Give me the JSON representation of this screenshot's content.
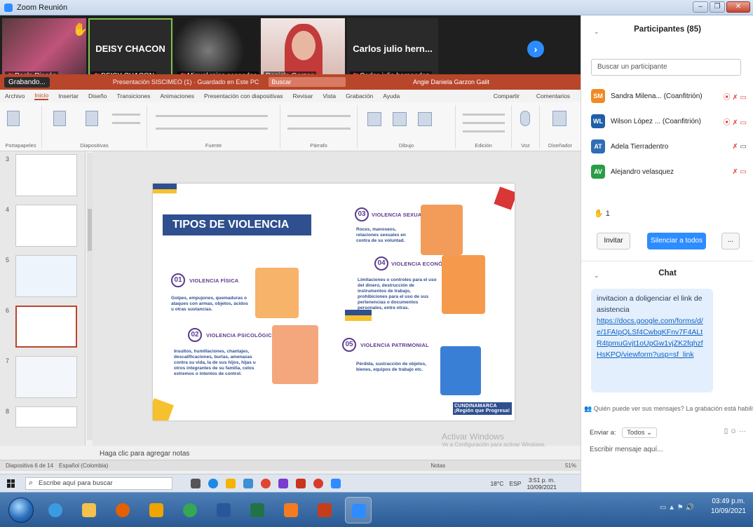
{
  "window": {
    "title": "Zoom Reunión",
    "controls": [
      "–",
      "❐",
      "✕"
    ]
  },
  "gallery": {
    "tiles": [
      {
        "name": "Paola Rincón",
        "big_name": "",
        "raised_hand": true
      },
      {
        "name": "DEISY CHACON",
        "big_name": "DEISY CHACON",
        "raised_hand": false
      },
      {
        "name": "Miguel rojas cespedes",
        "big_name": "",
        "raised_hand": false
      },
      {
        "name": "Daniela Garzon",
        "big_name": "",
        "raised_hand": false
      },
      {
        "name": "Carlos julio hernandez",
        "big_name": "Carlos julio hern...",
        "raised_hand": false
      }
    ],
    "next_label": "›"
  },
  "ppt": {
    "recording_label": "Grabando...",
    "file_name": "Presentación SISCIMEO (1) · Guardado en Este PC",
    "search": "Buscar",
    "user": "Angie Daniela Garzon Galit",
    "menu": [
      "Archivo",
      "Inicio",
      "Insertar",
      "Diseño",
      "Transiciones",
      "Animaciones",
      "Presentación con diapositivas",
      "Revisar",
      "Vista",
      "Grabación",
      "Ayuda"
    ],
    "share": "Compartir",
    "comments": "Comentarios",
    "ribbon_groups": [
      "Portapapeles",
      "Diapositivas",
      "Fuente",
      "Párrafo",
      "Dibujo",
      "Edición",
      "Voz",
      "Diseñador"
    ],
    "thumb_numbers": [
      "3",
      "4",
      "5",
      "6",
      "7",
      "8"
    ],
    "slide": {
      "title": "TIPOS DE VIOLENCIA",
      "items": [
        {
          "num": "01",
          "label": "VIOLENCIA FÍSICA",
          "desc": "Golpes, empujones, quemaduras o ataques con armas, objetos, ácidos u otras sustancias."
        },
        {
          "num": "02",
          "label": "VIOLENCIA PSICOLÓGICA",
          "desc": "Insultos, humillaciones, chantajes, descalificaciones, burlas, amenazas contra su vida, la de sus hijos, hijas u otros integrantes de su familia, celos extremos o intentos de control."
        },
        {
          "num": "03",
          "label": "VIOLENCIA SEXUAL",
          "desc": "Roces, manoseos, relaciones sexuales en contra de su voluntad."
        },
        {
          "num": "04",
          "label": "VIOLENCIA ECONÓMICA",
          "desc": "Limitaciones o controles para el uso del dinero, destrucción de instrumentos de trabajo, prohibiciones para el uso de sus pertenencias o documentos personales, entre otras."
        },
        {
          "num": "05",
          "label": "VIOLENCIA PATRIMONIAL",
          "desc": "Pérdida, sustracción de objetos, bienes, equipos de trabajo etc."
        }
      ],
      "logo": "CUNDINAMARCA ¡Región que Progresa!"
    },
    "notes_hint": "Haga clic para agregar notas",
    "activate_windows": "Activar Windows",
    "activate_sub": "Ve a Configuración para activar Windows.",
    "status_slide": "Diapositiva 6 de 14",
    "status_lang": "Español (Colombia)",
    "status_notes": "Notas",
    "status_zoom": "51%"
  },
  "inner_taskbar": {
    "search_placeholder": "Escribe aquí para buscar",
    "weather": "18°C",
    "lang": "ESP",
    "time": "3:51 p. m.",
    "date": "10/09/2021"
  },
  "participants": {
    "header": "Participantes (85)",
    "search_placeholder": "Buscar un participante",
    "people": [
      {
        "initials": "SM",
        "name": "Sandra Milena... (Coanfitrión)",
        "color": "#f08a24"
      },
      {
        "initials": "WL",
        "name": "Wilson López ... (Coanfitrión)",
        "color": "#1f5fa8"
      },
      {
        "initials": "AT",
        "name": "Adela Tierradentro",
        "color": "#2f6db5"
      },
      {
        "initials": "AV",
        "name": "Alejandro velasquez",
        "color": "#2a9d46"
      }
    ],
    "raised_count": "1",
    "invite": "Invitar",
    "mute_all": "Silenciar a todos",
    "more": "..."
  },
  "chat": {
    "header": "Chat",
    "message": "invitacion a doligenciar el link de asistencia",
    "link": "https://docs.google.com/forms/d/e/1FAIpQLSf4CwbqKFnv7F4ALtR4tpmuGvjt1oUpGw1vjZK2fqhzfHsKPQ/viewform?usp=sf_link",
    "warning": "Quién puede ver sus mensajes? La grabación está habilitada",
    "send_to_label": "Enviar a:",
    "send_to_value": "Todos",
    "input_placeholder": "Escribir mensaje aquí..."
  },
  "taskbar": {
    "time": "03:49 p.m.",
    "date": "10/09/2021"
  },
  "colors": {
    "zoom_blue": "#2d8cff",
    "ppt_red": "#b8462a",
    "slide_blue": "#2f4f8f",
    "slide_purple": "#5b3c8e"
  }
}
